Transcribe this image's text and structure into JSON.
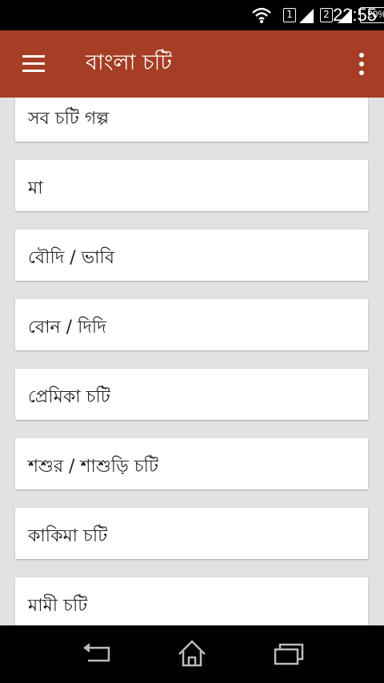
{
  "status_bar": {
    "time": "22:55",
    "battery_percent": "20%",
    "sim1_label": "1",
    "sim2_label": "2",
    "icons": [
      "wifi-icon",
      "sim1-signal-icon",
      "sim2-signal-icon",
      "battery-icon"
    ]
  },
  "app_bar": {
    "title": "বাংলা চটি",
    "menu_icon": "hamburger-menu-icon",
    "more_icon": "more-vert-icon"
  },
  "categories": [
    {
      "label": "সব চটি গল্প"
    },
    {
      "label": "মা"
    },
    {
      "label": "বৌদি / ভাবি"
    },
    {
      "label": "বোন / দিদি"
    },
    {
      "label": "প্রেমিকা চটি"
    },
    {
      "label": "শশুর / শাশুড়ি চটি"
    },
    {
      "label": "কাকিমা চটি"
    },
    {
      "label": "মামী চটি"
    }
  ],
  "nav_bar": {
    "buttons": [
      "back-icon",
      "home-icon",
      "recents-icon"
    ]
  },
  "colors": {
    "app_bar": "#a53e24",
    "background": "#e2e2e2",
    "card": "#ffffff",
    "status_bar": "#000000"
  }
}
